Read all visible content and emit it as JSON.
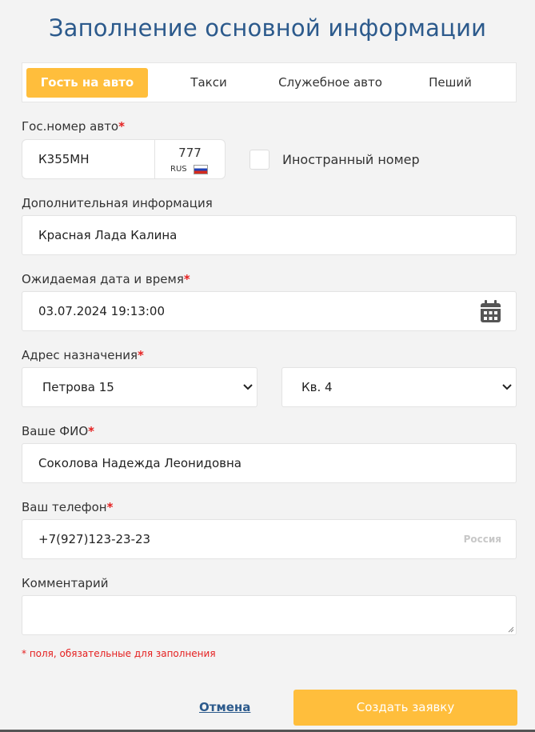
{
  "title": "Заполнение основной информации",
  "tabs": [
    {
      "label": "Гость на авто",
      "active": true
    },
    {
      "label": "Такси",
      "active": false
    },
    {
      "label": "Служебное авто",
      "active": false
    },
    {
      "label": "Пеший",
      "active": false
    }
  ],
  "plate": {
    "label": "Гос.номер авто",
    "required_mark": "*",
    "value": "К355МН",
    "region": "777",
    "country_code": "RUS",
    "flag_icon": "russia-flag-icon",
    "foreign_label": "Иностранный номер",
    "foreign_checked": false
  },
  "additional": {
    "label": "Дополнительная информация",
    "value": "Красная Лада Калина"
  },
  "datetime": {
    "label": "Ожидаемая дата и время",
    "required_mark": "*",
    "value": "03.07.2024 19:13:00",
    "icon": "calendar-icon"
  },
  "address": {
    "label": "Адрес назначения",
    "required_mark": "*",
    "street": "Петрова 15",
    "apartment": "Кв. 4"
  },
  "fio": {
    "label": "Ваше ФИО",
    "required_mark": "*",
    "value": "Соколова Надежда Леонидовна"
  },
  "phone": {
    "label": "Ваш телефон",
    "required_mark": "*",
    "value": "+7(927)123-23-23",
    "country": "Россия"
  },
  "comment": {
    "label": "Комментарий",
    "value": ""
  },
  "required_hint": "* поля, обязательные для заполнения",
  "actions": {
    "cancel_label": "Отмена",
    "submit_label": "Создать заявку"
  },
  "colors": {
    "accent": "#ffbe3c",
    "title": "#2c5a8c",
    "required": "#e52020"
  }
}
